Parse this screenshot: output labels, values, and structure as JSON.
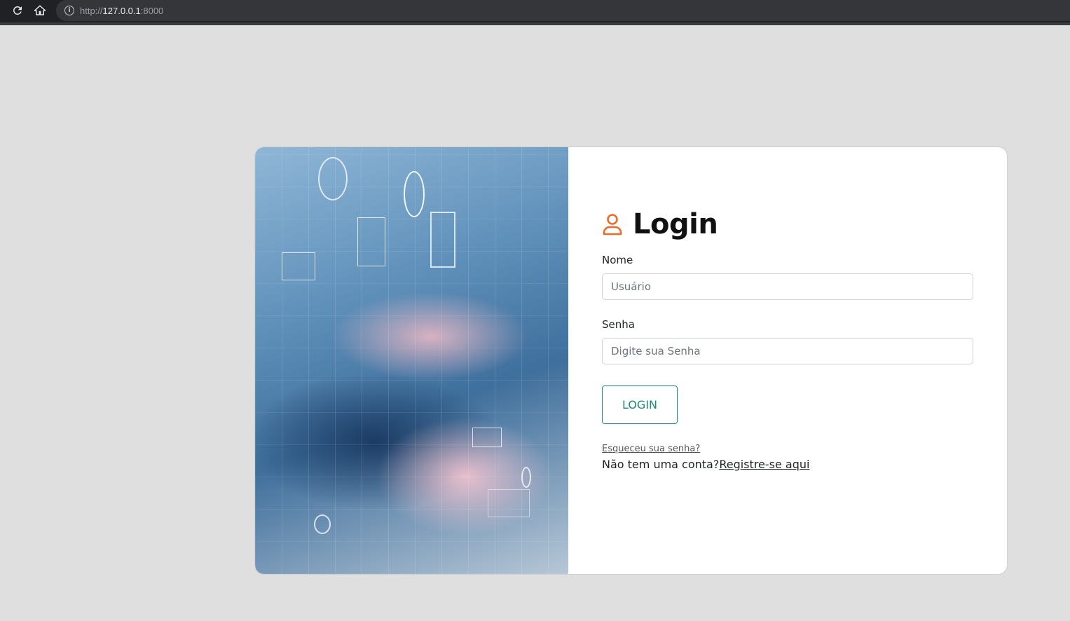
{
  "browser": {
    "url_scheme": "http://",
    "url_host": "127.0.0.1",
    "url_port": ":8000"
  },
  "hero": {
    "image_description": "typing-keyboard-tech-illustration"
  },
  "login": {
    "title": "Login",
    "username_label": "Nome",
    "username_placeholder": "Usuário",
    "password_label": "Senha",
    "password_placeholder": "Digite sua Senha",
    "submit_label": "LOGIN",
    "forgot_link": "Esqueceu sua senha?",
    "no_account_text": "Não tem uma conta?",
    "register_link": "Registre-se aqui"
  },
  "colors": {
    "accent": "#1a8a77",
    "user_icon": "#f26a2a",
    "background": "#dfdfdf"
  }
}
